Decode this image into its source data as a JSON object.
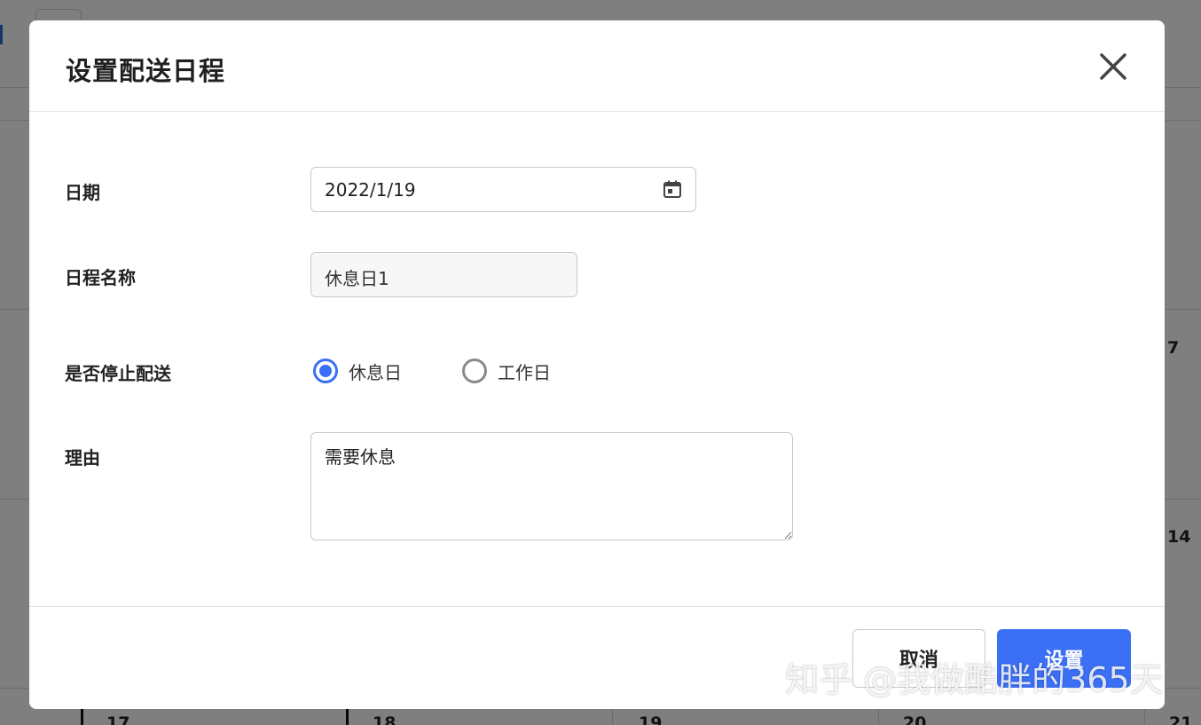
{
  "dialog": {
    "title": "设置配送日程",
    "fields": {
      "date_label": "日期",
      "date_value": "2022/1/19",
      "name_label": "日程名称",
      "name_value": "休息日1",
      "stop_label": "是否停止配送",
      "radio_options": [
        "休息日",
        "工作日"
      ],
      "radio_selected": "休息日",
      "reason_label": "理由",
      "reason_value": "需要休息"
    },
    "buttons": {
      "cancel": "取消",
      "set": "设置"
    }
  },
  "background": {
    "calendar_day_numbers": [
      "7",
      "14",
      "17",
      "18",
      "19",
      "20",
      "21"
    ]
  },
  "watermark": "知乎 @我做酷胖的365天",
  "colors": {
    "accent": "#3b6ff5",
    "overlay": "rgba(0,0,0,0.5)"
  },
  "icons": {
    "close": "close-icon",
    "calendar": "calendar-icon"
  }
}
